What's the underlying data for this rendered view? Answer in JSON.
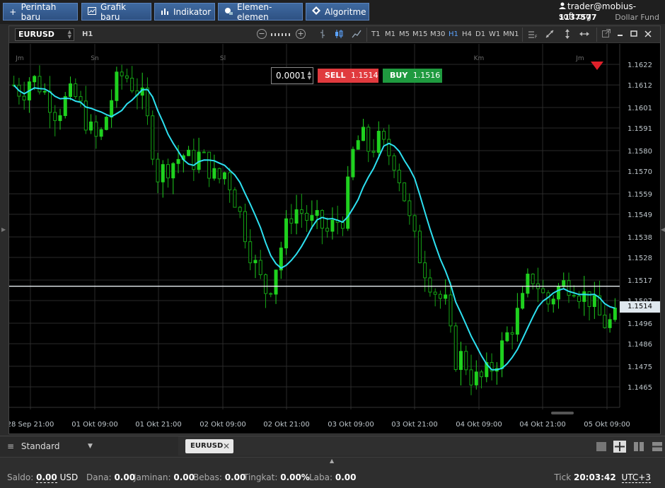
{
  "toolbar": {
    "new_order": "Perintah baru",
    "new_chart": "Grafik baru",
    "indicator": "Indikator",
    "elements": "Elemen-elemen",
    "algorithm": "Algoritme"
  },
  "account": {
    "user": "trader@mobius-soft.org",
    "number": "1137577",
    "fund": "Dollar Fund"
  },
  "chart_toolbar": {
    "symbol": "EURUSD",
    "timeframe": "H1",
    "timeframes": [
      "T1",
      "M1",
      "M5",
      "M15",
      "M30",
      "H1",
      "H4",
      "D1",
      "W1",
      "MN1"
    ],
    "active_timeframe": "H1"
  },
  "trade": {
    "lot": "0.0001",
    "sell_label": "SELL",
    "sell_price": "1.1514",
    "buy_label": "BUY",
    "buy_price": "1.1516"
  },
  "current_price": "1.1514",
  "colors": {
    "bull": "#1fd11f",
    "bear": "#15a315",
    "ma_line": "#2de0f0",
    "price_line": "#e8eef2",
    "sell": "#e03a3e",
    "buy": "#1f9a3f",
    "grid": "#2a2a2a"
  },
  "chart_data": {
    "type": "candlestick",
    "symbol": "EURUSD",
    "timeframe": "H1",
    "ylim": [
      1.1455,
      1.1632
    ],
    "y_ticks": [
      "1.1622",
      "1.1612",
      "1.1601",
      "1.1591",
      "1.1580",
      "1.1570",
      "1.1559",
      "1.1549",
      "1.1538",
      "1.1528",
      "1.1517",
      "1.1507",
      "1.1496",
      "1.1486",
      "1.1475",
      "1.1465"
    ],
    "x_ticks": [
      "28 Sep 21:00",
      "01 Okt 09:00",
      "01 Okt 21:00",
      "02 Okt 09:00",
      "02 Okt 21:00",
      "03 Okt 09:00",
      "03 Okt 21:00",
      "04 Okt 09:00",
      "04 Okt 21:00",
      "05 Okt 09:00"
    ],
    "day_labels": [
      "Jm",
      "Sn",
      "Sl",
      "Km",
      "Jm"
    ],
    "current_price": 1.1514,
    "close_path": [
      1.1612,
      1.1608,
      1.1616,
      1.1612,
      1.1606,
      1.1598,
      1.1604,
      1.1608,
      1.16,
      1.159,
      1.1584,
      1.1598,
      1.1612,
      1.1618,
      1.1612,
      1.1608,
      1.159,
      1.1568,
      1.1572,
      1.1575,
      1.1578,
      1.1574,
      1.1578,
      1.1572,
      1.1565,
      1.157,
      1.1558,
      1.1545,
      1.153,
      1.1518,
      1.151,
      1.1525,
      1.154,
      1.1552,
      1.155,
      1.1545,
      1.1545,
      1.154,
      1.1545,
      1.1548,
      1.1578,
      1.1588,
      1.158,
      1.1585,
      1.158,
      1.1575,
      1.156,
      1.154,
      1.1528,
      1.1518,
      1.151,
      1.1505,
      1.1478,
      1.148,
      1.147,
      1.1468,
      1.1472,
      1.1478,
      1.1488,
      1.1496,
      1.1505,
      1.152,
      1.1514,
      1.1505,
      1.1512,
      1.1515,
      1.1516,
      1.151,
      1.1508,
      1.15,
      1.1495,
      1.1498
    ]
  },
  "tabs": {
    "workspace": "Standard",
    "open_tab": "EURUSD"
  },
  "status": {
    "balance_label": "Saldo:",
    "balance_value": "0.00",
    "balance_currency": "USD",
    "equity_label": "Dana:",
    "equity_value": "0.00",
    "margin_label": "Jaminan:",
    "margin_value": "0.00",
    "free_label": "Bebas:",
    "free_value": "0.00",
    "level_label": "Tingkat:",
    "level_value": "0.00%",
    "profit_label": "Laba:",
    "profit_value": "0.00",
    "tick_label": "Tick",
    "clock": "20:03:42",
    "timezone": "UTC+3"
  }
}
